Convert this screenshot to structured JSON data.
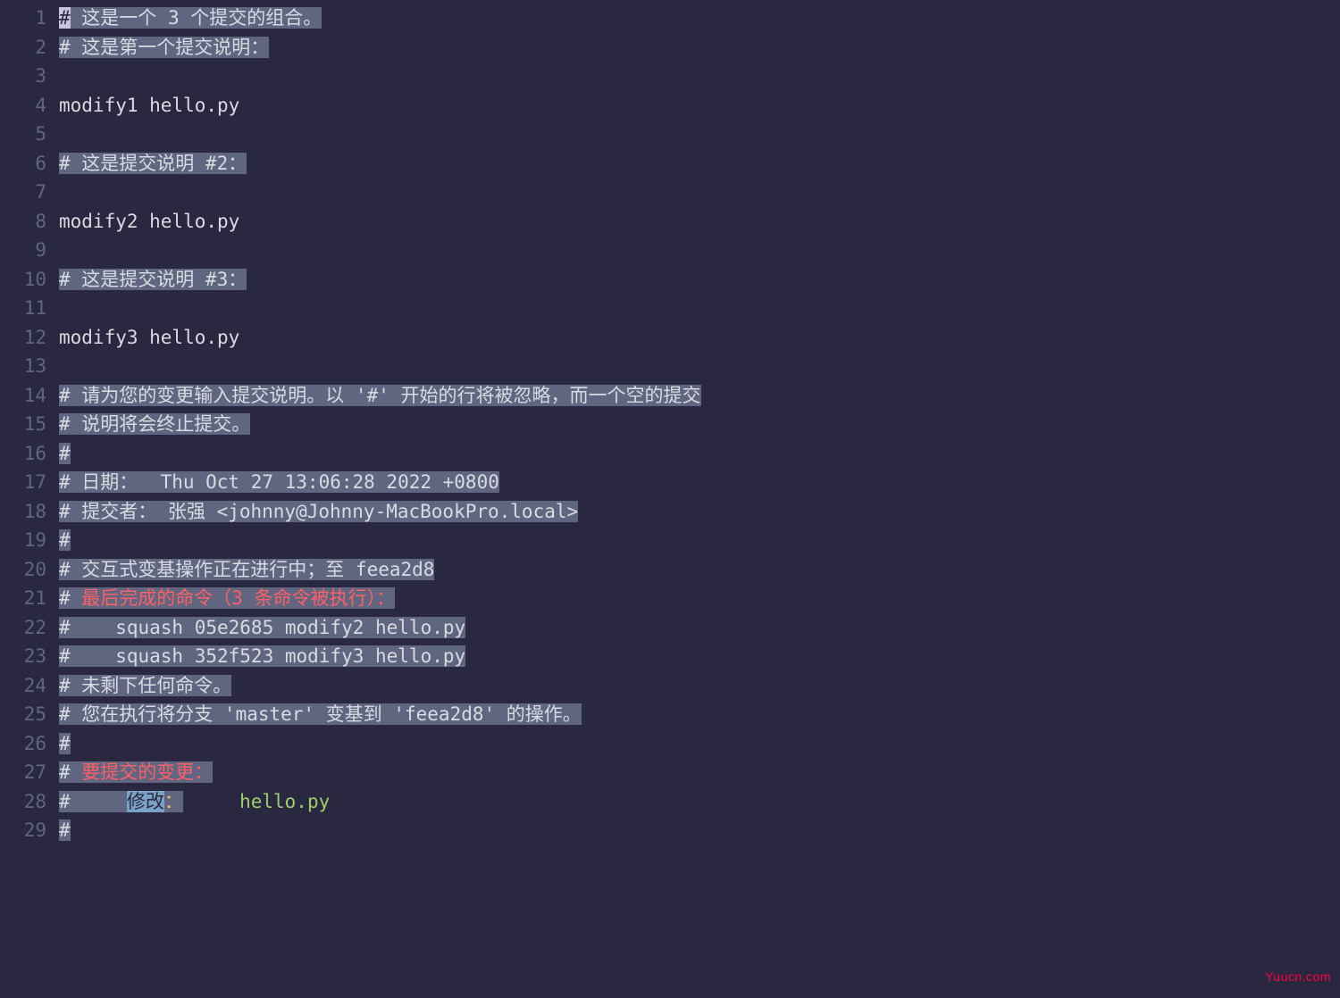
{
  "lines": [
    {
      "num": 1,
      "segments": [
        {
          "text": "#",
          "cls": "cursor"
        },
        {
          "text": " 这是一个 3 个提交的组合。",
          "cls": "hl"
        }
      ]
    },
    {
      "num": 2,
      "segments": [
        {
          "text": "# 这是第一个提交说明：",
          "cls": "hl"
        }
      ]
    },
    {
      "num": 3,
      "segments": []
    },
    {
      "num": 4,
      "segments": [
        {
          "text": "modify1 hello.py",
          "cls": ""
        }
      ]
    },
    {
      "num": 5,
      "segments": []
    },
    {
      "num": 6,
      "segments": [
        {
          "text": "# 这是提交说明 #2：",
          "cls": "hl"
        }
      ]
    },
    {
      "num": 7,
      "segments": []
    },
    {
      "num": 8,
      "segments": [
        {
          "text": "modify2 hello.py",
          "cls": ""
        }
      ]
    },
    {
      "num": 9,
      "segments": []
    },
    {
      "num": 10,
      "segments": [
        {
          "text": "# 这是提交说明 #3：",
          "cls": "hl"
        }
      ]
    },
    {
      "num": 11,
      "segments": []
    },
    {
      "num": 12,
      "segments": [
        {
          "text": "modify3 hello.py",
          "cls": ""
        }
      ]
    },
    {
      "num": 13,
      "segments": []
    },
    {
      "num": 14,
      "segments": [
        {
          "text": "# 请为您的变更输入提交说明。以 '#' 开始的行将被忽略，而一个空的提交",
          "cls": "hl"
        }
      ]
    },
    {
      "num": 15,
      "segments": [
        {
          "text": "# 说明将会终止提交。",
          "cls": "hl"
        }
      ]
    },
    {
      "num": 16,
      "segments": [
        {
          "text": "#",
          "cls": "hl"
        }
      ]
    },
    {
      "num": 17,
      "segments": [
        {
          "text": "# 日期：  Thu Oct 27 13:06:28 2022 +0800",
          "cls": "hl"
        }
      ]
    },
    {
      "num": 18,
      "segments": [
        {
          "text": "# 提交者： 张强 <johnny@Johnny-MacBookPro.local>",
          "cls": "hl"
        }
      ]
    },
    {
      "num": 19,
      "segments": [
        {
          "text": "#",
          "cls": "hl"
        }
      ]
    },
    {
      "num": 20,
      "segments": [
        {
          "text": "# 交互式变基操作正在进行中；至 feea2d8",
          "cls": "hl"
        }
      ]
    },
    {
      "num": 21,
      "segments": [
        {
          "text": "# ",
          "cls": "hl"
        },
        {
          "text": "最后完成的命令（3 条命令被执行）：",
          "cls": "hl red"
        }
      ]
    },
    {
      "num": 22,
      "segments": [
        {
          "text": "#    squash 05e2685 modify2 hello.py",
          "cls": "hl"
        }
      ]
    },
    {
      "num": 23,
      "segments": [
        {
          "text": "#    squash 352f523 modify3 hello.py",
          "cls": "hl"
        }
      ]
    },
    {
      "num": 24,
      "segments": [
        {
          "text": "# 未剩下任何命令。",
          "cls": "hl"
        }
      ]
    },
    {
      "num": 25,
      "segments": [
        {
          "text": "# 您在执行将分支 'master' 变基到 'feea2d8' 的操作。",
          "cls": "hl"
        }
      ]
    },
    {
      "num": 26,
      "segments": [
        {
          "text": "#",
          "cls": "hl"
        }
      ]
    },
    {
      "num": 27,
      "segments": [
        {
          "text": "# ",
          "cls": "hl"
        },
        {
          "text": "要提交的变更：",
          "cls": "hl red"
        }
      ]
    },
    {
      "num": 28,
      "segments": [
        {
          "text": "#",
          "cls": "hl"
        },
        {
          "text": "     ",
          "cls": "hl"
        },
        {
          "text": "修改",
          "cls": "lightblue"
        },
        {
          "text": "：",
          "cls": "hl yellow"
        },
        {
          "text": "     ",
          "cls": ""
        },
        {
          "text": "hello.py",
          "cls": "green"
        }
      ]
    },
    {
      "num": 29,
      "segments": [
        {
          "text": "#",
          "cls": "hl"
        }
      ]
    }
  ],
  "watermark": "Yuucn.com"
}
